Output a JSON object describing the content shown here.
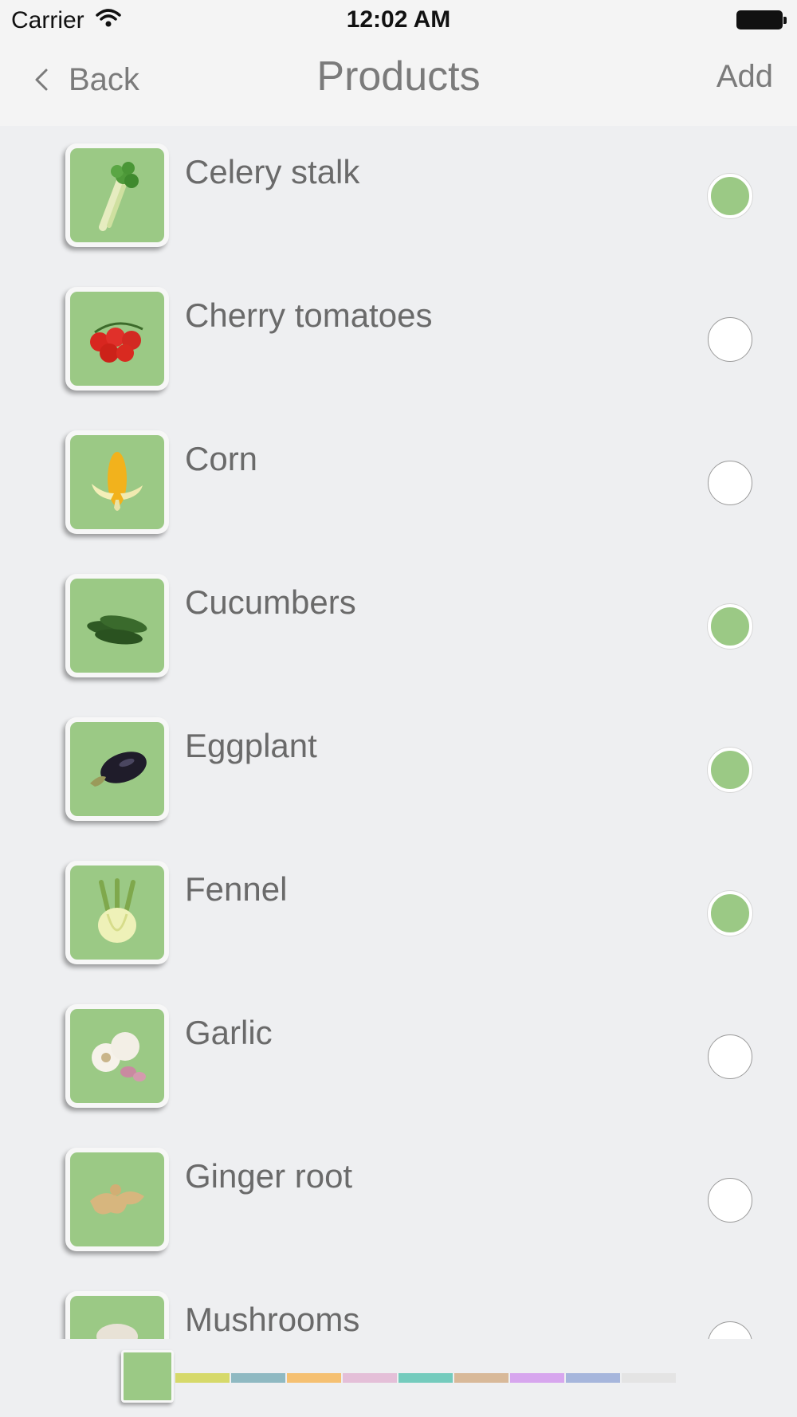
{
  "status_bar": {
    "carrier": "Carrier",
    "time": "12:02 AM"
  },
  "nav": {
    "back_label": "Back",
    "title": "Products",
    "add_label": "Add"
  },
  "products": [
    {
      "label": "Celery stalk",
      "icon": "celery-icon",
      "selected": true
    },
    {
      "label": "Cherry tomatoes",
      "icon": "tomato-icon",
      "selected": false
    },
    {
      "label": "Corn",
      "icon": "corn-icon",
      "selected": false
    },
    {
      "label": "Cucumbers",
      "icon": "cucumber-icon",
      "selected": true
    },
    {
      "label": "Eggplant",
      "icon": "eggplant-icon",
      "selected": true
    },
    {
      "label": "Fennel",
      "icon": "fennel-icon",
      "selected": true
    },
    {
      "label": "Garlic",
      "icon": "garlic-icon",
      "selected": false
    },
    {
      "label": "Ginger root",
      "icon": "ginger-icon",
      "selected": false
    },
    {
      "label": "Mushrooms",
      "icon": "mushroom-icon",
      "selected": false
    }
  ],
  "colors": {
    "accent_green": "#9bc985",
    "palette": [
      "#d6d96a",
      "#8fb9c2",
      "#f5c072",
      "#e4bfd8",
      "#74cbbd",
      "#d8b999",
      "#d7a6ee",
      "#a6b6dc",
      "#e4e4e4"
    ]
  }
}
